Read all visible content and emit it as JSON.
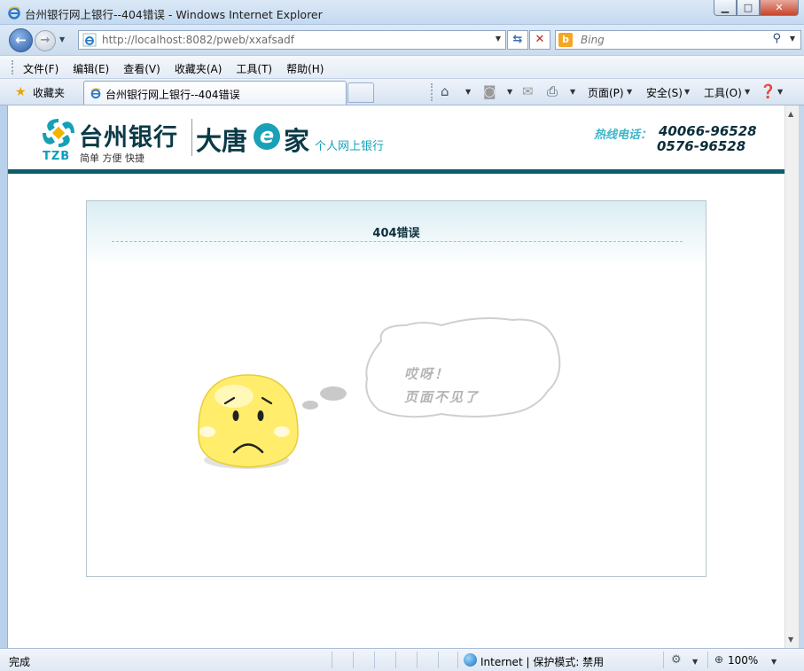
{
  "window": {
    "title": "台州银行网上银行--404错误 - Windows Internet Explorer"
  },
  "address_bar": {
    "url": "http://localhost:8082/pweb/xxafsadf",
    "search_placeholder": "Bing"
  },
  "menu": {
    "items": [
      "文件(F)",
      "编辑(E)",
      "查看(V)",
      "收藏夹(A)",
      "工具(T)",
      "帮助(H)"
    ]
  },
  "command_bar": {
    "favorites_label": "收藏夹",
    "tab_title": "台州银行网上银行--404错误",
    "page_menu": "页面(P)",
    "safety_menu": "安全(S)",
    "tools_menu": "工具(O)"
  },
  "page": {
    "bank_name": "台州银行",
    "bank_abbr": "TZB",
    "slogan": "简单 方便 快捷",
    "brand_part1": "大唐",
    "brand_e": "e",
    "brand_part2": "家",
    "netbank_label": "个人网上银行",
    "hotline_label": "热线电话：",
    "hotline_1": "40066-96528",
    "hotline_2": "0576-96528",
    "error_title": "404错误",
    "cloud_line1": "哎呀！",
    "cloud_line2": "页面不见了"
  },
  "status_bar": {
    "status": "完成",
    "zone": "Internet | 保护模式: 禁用",
    "zoom": "100%"
  },
  "colors": {
    "brand_dark": "#0a3a47",
    "brand_teal": "#17a2b8",
    "header_band": "#0f5d6c"
  }
}
